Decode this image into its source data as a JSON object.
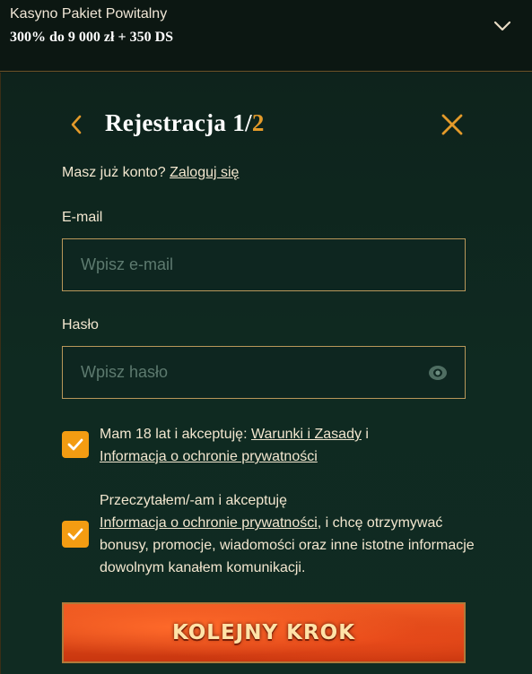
{
  "promo": {
    "title": "Kasyno Pakiet Powitalny",
    "subtitle": "300% do 9 000 zł + 350 DS"
  },
  "registration": {
    "title_main": "Rejestracja 1/",
    "title_total": "2",
    "account_prompt": "Masz już konto?",
    "login_link": "Zaloguj się"
  },
  "email": {
    "label": "E-mail",
    "placeholder": "Wpisz e-mail"
  },
  "password": {
    "label": "Hasło",
    "placeholder": "Wpisz hasło"
  },
  "consents": {
    "terms": {
      "checked": true,
      "text_before": "Mam 18 lat i akceptuję: ",
      "terms_link": "Warunki i Zasady",
      "text_middle": " i",
      "privacy_link": "Informacja o ochronie prywatności"
    },
    "marketing": {
      "checked": true,
      "text_before": "Przeczytałem/-am i akceptuję",
      "privacy_link": "Informacja o ochronie prywatności",
      "text_after": ", i chcę otrzymywać bonusy, promocje, wiadomości oraz inne istotne informacje dowolnym kanałem komunikacji."
    }
  },
  "next_button": {
    "label": "KOLEJNY KROK"
  },
  "icons": {
    "expand": "chevron-down-icon",
    "back": "chevron-left-icon",
    "close": "close-icon",
    "show_password": "eye-icon",
    "checkmark": "checkmark-icon"
  },
  "colors": {
    "accent": "#e39a2a",
    "checkbox": "#f39c12",
    "button": "#e84a1a",
    "input_border": "#b8975a"
  }
}
